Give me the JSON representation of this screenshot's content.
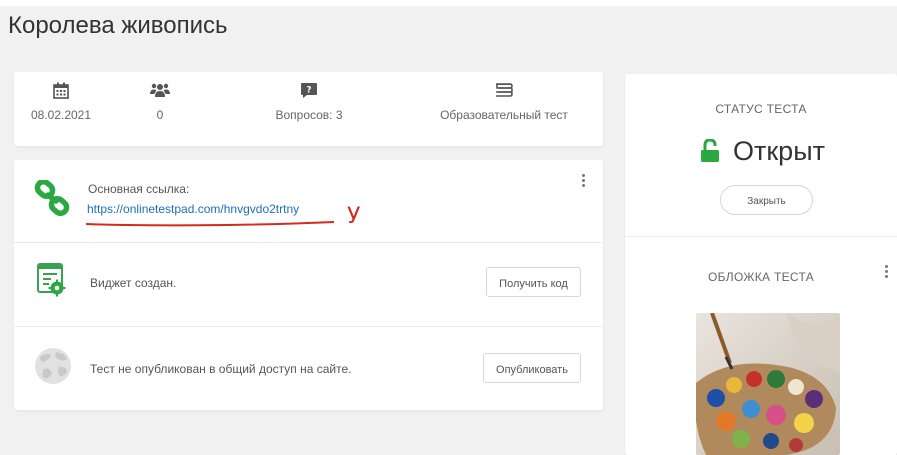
{
  "page": {
    "title": "Королева живопись"
  },
  "stats": [
    {
      "icon": "calendar-icon",
      "value": "08.02.2021"
    },
    {
      "icon": "users-icon",
      "value": "0"
    },
    {
      "icon": "question-icon",
      "value": "Вопросов: 3"
    },
    {
      "icon": "book-icon",
      "value": "Образовательный тест"
    }
  ],
  "main": {
    "link_label": "Основная ссылка:",
    "link_url": "https://onlinetestpad.com/hnvgvdo2trtny",
    "annotation": "У",
    "widget_text": "Виджет создан.",
    "widget_button": "Получить код",
    "publish_text": "Тест не опубликован в общий доступ на сайте.",
    "publish_button": "Опубликовать"
  },
  "status": {
    "label": "СТАТУС ТЕСТА",
    "value": "Открыт",
    "close_button": "Закрыть"
  },
  "cover": {
    "label": "ОБЛОЖКА ТЕСТА"
  },
  "colors": {
    "link": "#1e6fb7",
    "accent_green": "#2ca843",
    "annotation_red": "#d42a1f"
  }
}
